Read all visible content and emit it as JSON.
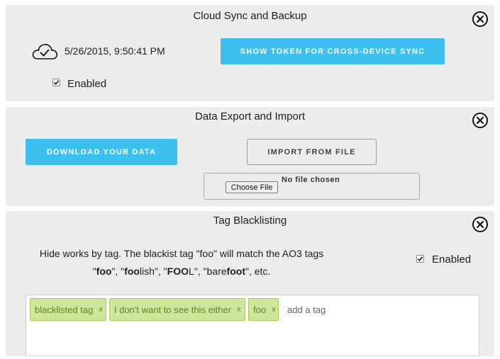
{
  "cloud": {
    "title": "Cloud Sync and Backup",
    "timestamp": "5/26/2015, 9:50:41 PM",
    "sync_button": "SHOW TOKEN FOR CROSS-DEVICE SYNC",
    "enabled_label": "Enabled",
    "enabled_checked": true
  },
  "data_io": {
    "title": "Data Export and Import",
    "download_button": "DOWNLOAD YOUR DATA",
    "import_button": "IMPORT FROM FILE",
    "choose_file_button": "Choose File",
    "no_file_text": "No file chosen"
  },
  "blacklist": {
    "title": "Tag Blacklisting",
    "description_line1": "Hide works by tag. The blackist tag \"foo\" will match the AO3 tags",
    "desc2": {
      "q1": "\"",
      "w1_bold": "foo",
      "q2": "\", \"",
      "w2_bold": "foo",
      "w2_rest": "lish",
      "q3": "\", \"",
      "w3_bold": "FOO",
      "w3_rest": "L",
      "q4": "\", \"",
      "w4_pre": "bare",
      "w4_bold": "foot",
      "q5": "\", etc."
    },
    "enabled_label": "Enabled",
    "enabled_checked": true,
    "tags": [
      {
        "label": "blacklisted tag",
        "remove": "x"
      },
      {
        "label": "I don't want to see this either",
        "remove": "x"
      },
      {
        "label": "foo",
        "remove": "x"
      }
    ],
    "add_placeholder": "add a tag"
  }
}
